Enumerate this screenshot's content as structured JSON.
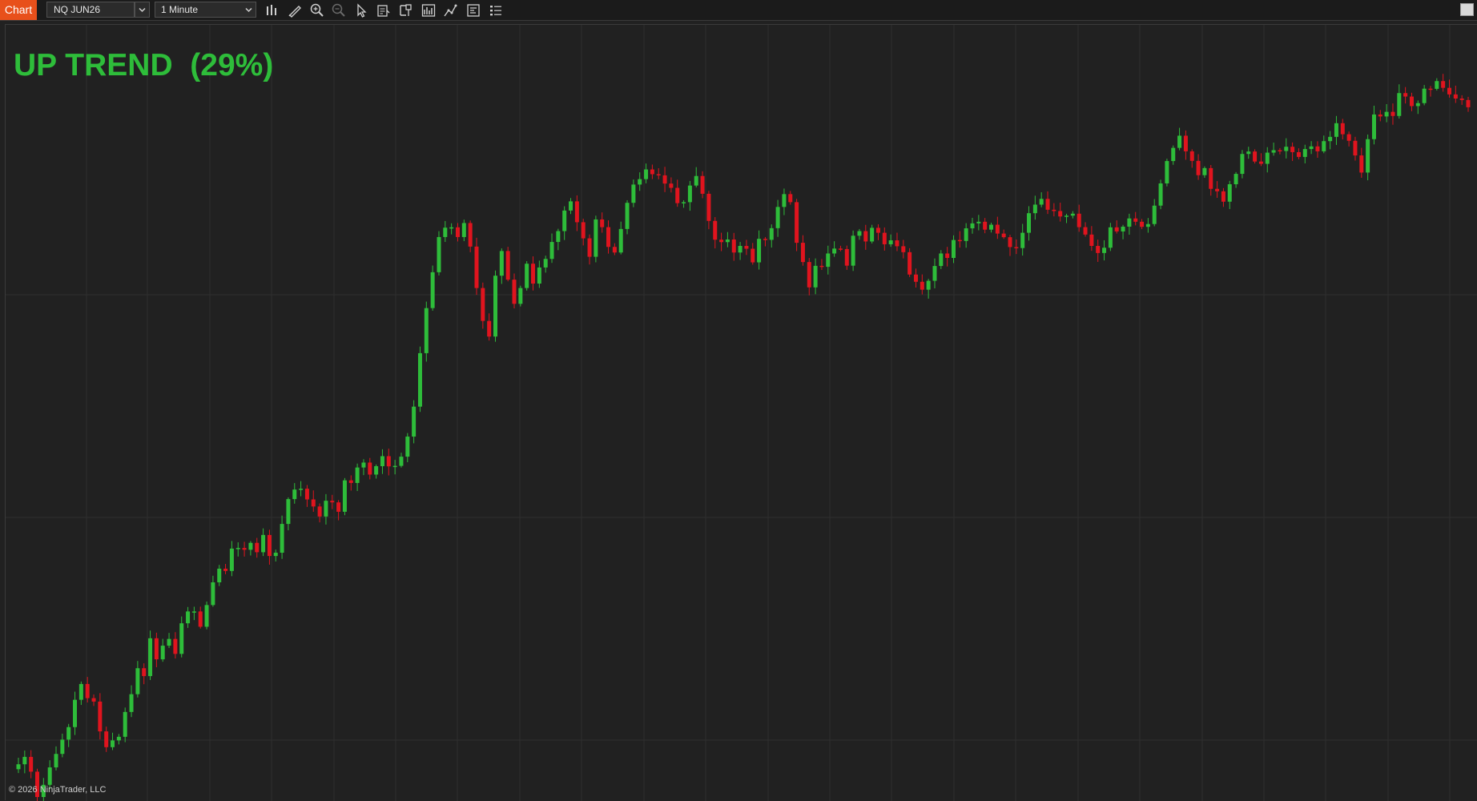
{
  "toolbar": {
    "chart_tab": "Chart",
    "instrument": "NQ JUN26",
    "interval": "1 Minute",
    "icons": [
      "bar-type-icon",
      "drawing-tools-icon",
      "zoom-in-icon",
      "zoom-out-icon",
      "pointer-icon",
      "data-box-icon",
      "properties-icon",
      "indicators-icon",
      "strategies-icon",
      "templates-icon",
      "chart-trader-icon"
    ]
  },
  "indicator": {
    "label": "UP TREND  (29%)",
    "color": "#2ebd3a"
  },
  "colors": {
    "background": "#212121",
    "up_candle": "#2ebd3a",
    "down_candle": "#e0141e",
    "grid": "#2e2e2e",
    "accent": "#e8501b"
  },
  "chart_data": {
    "type": "candlestick",
    "title": "",
    "grid": true,
    "x_axis_labels": "",
    "y_axis_labels": "",
    "closes": [
      890.5,
      895.0,
      886.0,
      870.6,
      878.0,
      888.6,
      896.8,
      905.5,
      913.1,
      929.7,
      939.3,
      930.7,
      928.6,
      910.5,
      900.9,
      905.0,
      907.2,
      922.3,
      933.1,
      948.9,
      944.1,
      967.1,
      954.3,
      962.6,
      966.7,
      957.6,
      976.2,
      983.4,
      983.4,
      974.1,
      987.3,
      1001.1,
      1009.4,
      1008.0,
      1021.6,
      1022.0,
      1020.9,
      1025.1,
      1019.4,
      1029.9,
      1017.1,
      1019.1,
      1036.6,
      1051.7,
      1057.5,
      1058.0,
      1051.5,
      1047.2,
      1041.1,
      1050.7,
      1049.7,
      1044.0,
      1063.1,
      1061.5,
      1070.9,
      1073.9,
      1066.6,
      1071.7,
      1077.8,
      1071.6,
      1071.9,
      1077.5,
      1089.7,
      1107.9,
      1140.4,
      1167.8,
      1189.6,
      1211.0,
      1216.7,
      1216.9,
      1211.0,
      1219.5,
      1205.2,
      1180.0,
      1160.0,
      1150.5,
      1187.5,
      1202.5,
      1185.1,
      1170.4,
      1180.0,
      1194.8,
      1182.7,
      1192.5,
      1197.7,
      1208.0,
      1214.6,
      1227.1,
      1232.7,
      1220.0,
      1210.2,
      1199.0,
      1221.7,
      1217.0,
      1205.0,
      1201.6,
      1215.9,
      1231.8,
      1242.9,
      1246.2,
      1252.1,
      1249.2,
      1248.5,
      1243.5,
      1240.9,
      1231.6,
      1232.2,
      1242.3,
      1248.1,
      1237.3,
      1220.8,
      1209.4,
      1207.9,
      1209.5,
      1201.6,
      1205.6,
      1203.9,
      1195.6,
      1209.9,
      1209.3,
      1216.4,
      1229.3,
      1237.1,
      1232.2,
      1207.5,
      1195.8,
      1180.4,
      1193.5,
      1192.9,
      1201.0,
      1204.0,
      1203.7,
      1193.6,
      1211.8,
      1214.6,
      1208.3,
      1216.6,
      1213.6,
      1206.6,
      1209.0,
      1205.4,
      1201.8,
      1188.2,
      1183.8,
      1179.0,
      1184.4,
      1193.4,
      1201.0,
      1198.3,
      1209.2,
      1208.6,
      1216.3,
      1219.3,
      1220.3,
      1215.5,
      1218.5,
      1213.1,
      1210.9,
      1204.9,
      1204.3,
      1213.6,
      1225.5,
      1230.7,
      1234.2,
      1227.6,
      1226.8,
      1223.5,
      1224.0,
      1225.2,
      1217.0,
      1212.5,
      1205.6,
      1201.3,
      1204.5,
      1216.9,
      1214.4,
      1217.3,
      1222.3,
      1220.3,
      1217.2,
      1218.9,
      1230.1,
      1243.6,
      1257.2,
      1265.2,
      1272.6,
      1263.1,
      1257.3,
      1248.6,
      1252.9,
      1240.3,
      1238.8,
      1232.5,
      1243.1,
      1249.4,
      1261.5,
      1263.0,
      1256.9,
      1255.5,
      1262.3,
      1263.8,
      1263.3,
      1265.9,
      1262.6,
      1259.7,
      1264.5,
      1266.1,
      1263.1,
      1269.3,
      1271.9,
      1280.2,
      1273.5,
      1269.5,
      1260.6,
      1250.2,
      1270.5,
      1285.5,
      1284.3,
      1287.1,
      1284.6,
      1298.5,
      1296.4,
      1290.6,
      1292.4,
      1301.2,
      1301.1,
      1305.8,
      1301.7,
      1297.7,
      1295.2,
      1294.3,
      1289.9
    ]
  }
}
